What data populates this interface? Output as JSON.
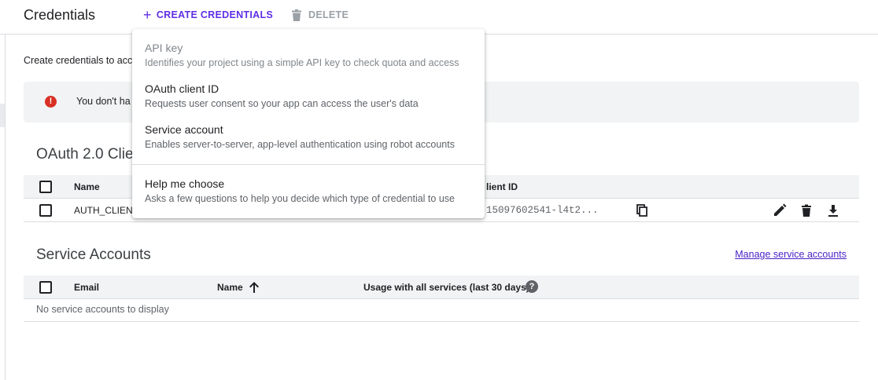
{
  "header": {
    "title": "Credentials",
    "create_label": "CREATE CREDENTIALS",
    "delete_label": "DELETE"
  },
  "intro_text": "Create credentials to acc",
  "alert": {
    "message": "You don't ha"
  },
  "oauth": {
    "section_title": "OAuth 2.0 Clie",
    "columns": {
      "name": "Name",
      "client_id": "lient ID"
    },
    "rows": [
      {
        "name": "AUTH_CLIEN",
        "client_id": "15097602541-l4t2..."
      }
    ]
  },
  "service_accounts": {
    "section_title": "Service Accounts",
    "manage_link": "Manage service accounts",
    "columns": {
      "email": "Email",
      "name": "Name",
      "usage": "Usage with all services (last 30 days)"
    },
    "empty_text": "No service accounts to display"
  },
  "menu": {
    "items": [
      {
        "title": "API key",
        "desc": "Identifies your project using a simple API key to check quota and access"
      },
      {
        "title": "OAuth client ID",
        "desc": "Requests user consent so your app can access the user's data"
      },
      {
        "title": "Service account",
        "desc": "Enables server-to-server, app-level authentication using robot accounts"
      },
      {
        "title": "Help me choose",
        "desc": "Asks a few questions to help you decide which type of credential to use"
      }
    ]
  },
  "icons": {
    "create": "plus-icon",
    "delete": "trash-icon",
    "alert": "error-icon",
    "copy": "copy-icon",
    "edit": "pencil-icon",
    "row_delete": "trash-icon",
    "download": "download-icon",
    "sort": "arrow-up-icon",
    "help": "help-circle-icon"
  },
  "colors": {
    "accent": "#5f2ee5",
    "link": "#4b23c7",
    "error": "#d93025",
    "header_bg": "#f1f3f4"
  }
}
